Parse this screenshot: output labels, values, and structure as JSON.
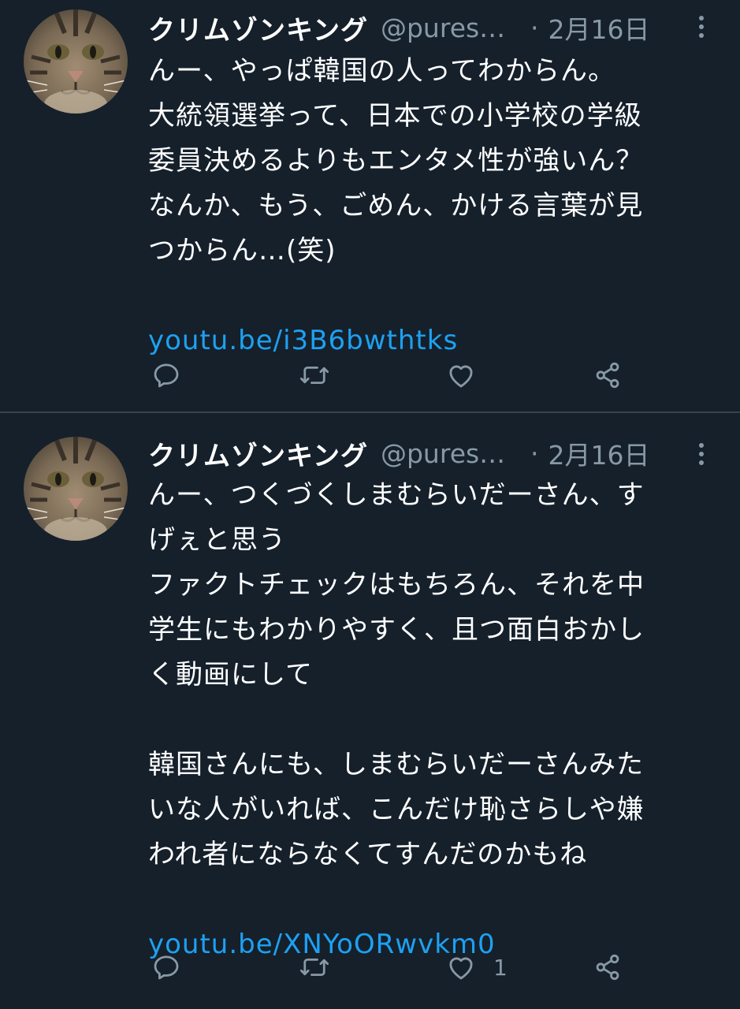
{
  "theme": {
    "background": "#15202b",
    "text": "#ffffff",
    "muted": "#8899a6",
    "link": "#1da1f2",
    "divider": "#38444d"
  },
  "tweets": [
    {
      "author": {
        "display_name": "クリムゾンキング",
        "handle": "@pures…",
        "avatar": "tabby-cat-avatar"
      },
      "separator": "·",
      "date": "2月16日",
      "lines": [
        "んー、やっぱ韓国の人ってわからん。",
        "大統領選挙って、日本での小学校の学級",
        "委員決めるよりもエンタメ性が強いん？",
        "なんか、もう、ごめん、かける言葉が見",
        "つからん…(笑)"
      ],
      "link": "youtu.be/i3B6bwthtks",
      "actions": {
        "reply_icon": "reply-icon",
        "retweet_icon": "retweet-icon",
        "like_icon": "like-icon",
        "share_icon": "share-icon",
        "like_count": ""
      }
    },
    {
      "author": {
        "display_name": "クリムゾンキング",
        "handle": "@pures…",
        "avatar": "tabby-cat-avatar"
      },
      "separator": "·",
      "date": "2月16日",
      "lines": [
        "んー、つくづくしまむらいだーさん、す",
        "げぇと思う",
        "ファクトチェックはもちろん、それを中",
        "学生にもわかりやすく、且つ面白おかし",
        "く動画にして",
        "",
        "韓国さんにも、しまむらいだーさんみた",
        "いな人がいれば、こんだけ恥さらしや嫌",
        "われ者にならなくてすんだのかもね"
      ],
      "link": "youtu.be/XNYoORwvkm0",
      "actions": {
        "reply_icon": "reply-icon",
        "retweet_icon": "retweet-icon",
        "like_icon": "like-icon",
        "share_icon": "share-icon",
        "like_count": "1"
      }
    }
  ]
}
